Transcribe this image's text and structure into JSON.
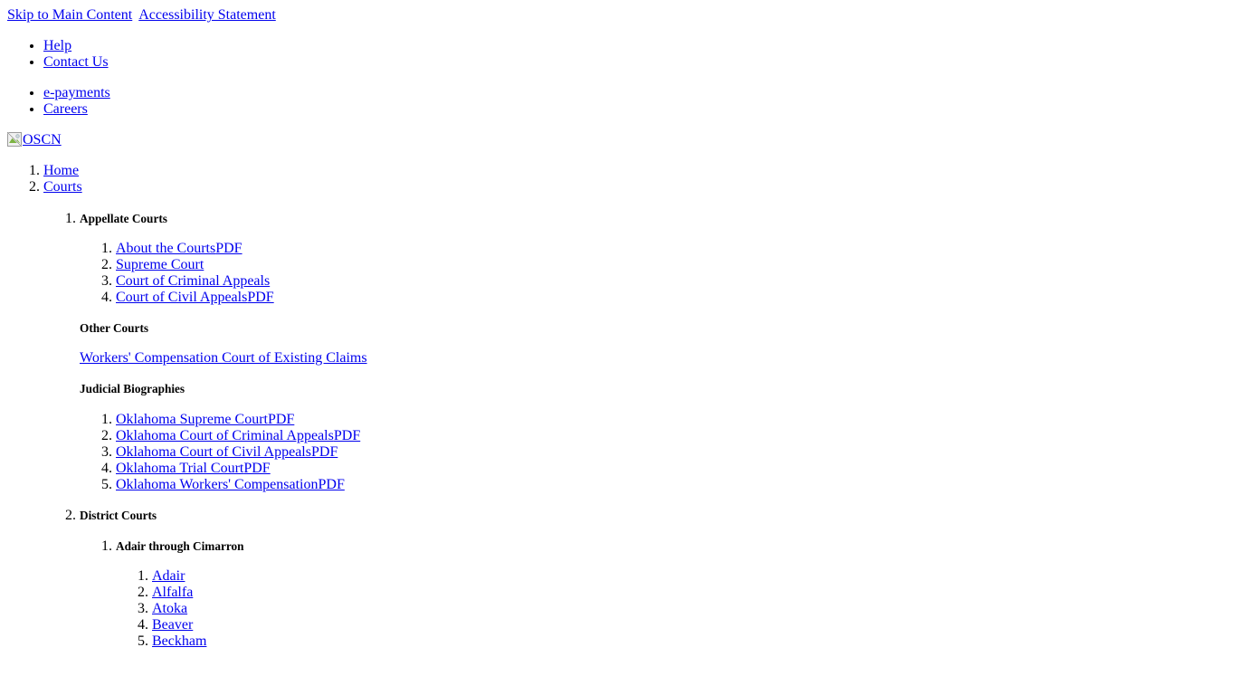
{
  "skip_links": [
    {
      "label": "Skip to Main Content",
      "name": "skip-to-main-content-link"
    },
    {
      "label": "Accessibility Statement",
      "name": "accessibility-statement-link"
    }
  ],
  "utility_nav_primary": [
    {
      "label": "Help"
    },
    {
      "label": "Contact Us"
    }
  ],
  "utility_nav_secondary": [
    {
      "label": "e-payments"
    },
    {
      "label": "Careers"
    }
  ],
  "logo": {
    "alt_text": "OSCN",
    "icon": "broken-image-icon"
  },
  "breadcrumb": [
    {
      "label": "Home"
    },
    {
      "label": "Courts"
    }
  ],
  "sections": [
    {
      "heading": "Appellate Courts",
      "links": [
        {
          "label": "About the Courts",
          "suffix": "PDF"
        },
        {
          "label": "Supreme Court",
          "suffix": ""
        },
        {
          "label": "Court of Criminal Appeals",
          "suffix": ""
        },
        {
          "label": "Court of Civil Appeals",
          "suffix": "PDF"
        }
      ],
      "subsections": [
        {
          "heading": "Other Courts",
          "paragraph_link": "Workers' Compensation Court of Existing Claims"
        },
        {
          "heading": "Judicial Biographies",
          "links": [
            {
              "label": "Oklahoma Supreme Court",
              "suffix": "PDF"
            },
            {
              "label": "Oklahoma Court of Criminal Appeals",
              "suffix": "PDF"
            },
            {
              "label": "Oklahoma Court of Civil Appeals",
              "suffix": "PDF"
            },
            {
              "label": "Oklahoma Trial Court",
              "suffix": "PDF"
            },
            {
              "label": "Oklahoma Workers' Compensation",
              "suffix": "PDF"
            }
          ]
        }
      ]
    },
    {
      "heading": "District Courts",
      "group": {
        "heading": "Adair through Cimarron",
        "counties": [
          {
            "label": "Adair"
          },
          {
            "label": "Alfalfa"
          },
          {
            "label": "Atoka"
          },
          {
            "label": "Beaver"
          },
          {
            "label": "Beckham"
          }
        ]
      }
    }
  ],
  "colors": {
    "link": "#0000EE",
    "text": "#000000",
    "background": "#FFFFFF"
  }
}
